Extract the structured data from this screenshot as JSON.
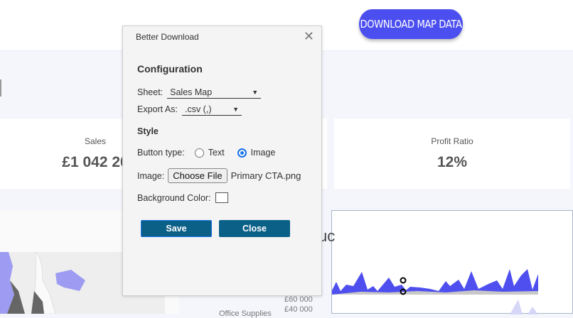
{
  "header": {
    "download_button": "DOWNLOAD MAP DATA",
    "accent": "#4c4ff0"
  },
  "kpis": [
    {
      "label": "Sales",
      "value": "£1 042 20"
    },
    {
      "label": "Profit Ratio",
      "value": "12%"
    }
  ],
  "chart": {
    "title_fragment": "uc",
    "axis_ticks": [
      "£60 000",
      "£40 000"
    ],
    "category_label": "Office Supplies"
  },
  "modal": {
    "title": "Better Download",
    "configuration_heading": "Configuration",
    "sheet_label": "Sheet:",
    "sheet_value": "Sales Map",
    "export_label": "Export As:",
    "export_value": ".csv (,)",
    "style_heading": "Style",
    "button_type_label": "Button type:",
    "button_type_options": [
      "Text",
      "Image"
    ],
    "button_type_selected": "Image",
    "image_label": "Image:",
    "choose_file": "Choose File",
    "file_name": "Primary CTA.png",
    "bg_color_label": "Background Color:",
    "bg_color": "#ffffff",
    "save": "Save",
    "close": "Close",
    "button_color": "#0b6088"
  }
}
